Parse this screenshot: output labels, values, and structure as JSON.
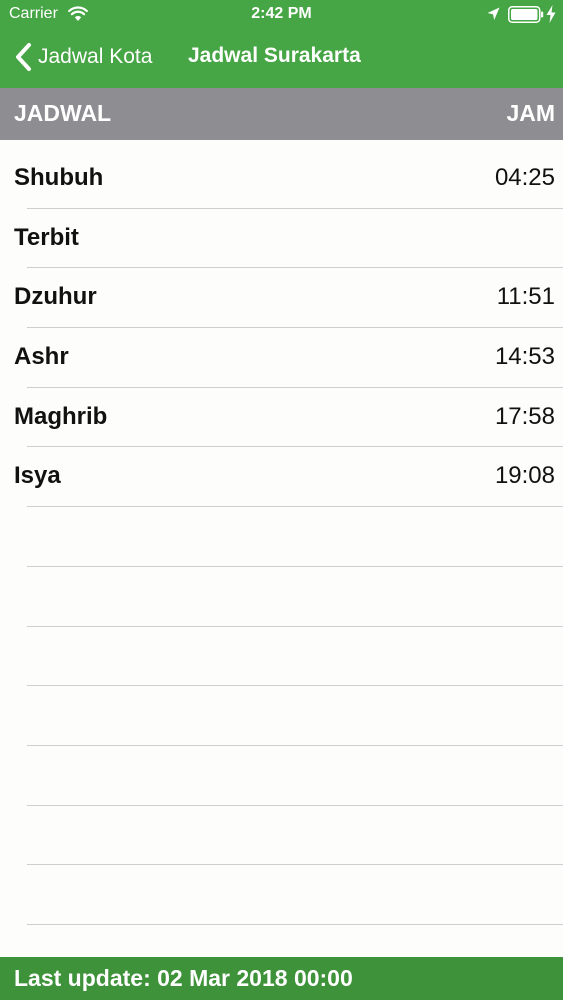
{
  "status_bar": {
    "carrier": "Carrier",
    "time": "2:42 PM",
    "icons": [
      "wifi-icon",
      "location-arrow-icon",
      "battery-icon",
      "charging-bolt-icon"
    ]
  },
  "nav": {
    "back_label": "Jadwal Kota",
    "title": "Jadwal Surakarta"
  },
  "table": {
    "headers": {
      "name": "JADWAL",
      "time": "JAM"
    },
    "rows": [
      {
        "name": "Shubuh",
        "time": "04:25"
      },
      {
        "name": "Terbit",
        "time": ""
      },
      {
        "name": "Dzuhur",
        "time": "11:51"
      },
      {
        "name": "Ashr",
        "time": "14:53"
      },
      {
        "name": "Maghrib",
        "time": "17:58"
      },
      {
        "name": "Isya",
        "time": "19:08"
      },
      {
        "name": "",
        "time": ""
      },
      {
        "name": "",
        "time": ""
      },
      {
        "name": "",
        "time": ""
      },
      {
        "name": "",
        "time": ""
      },
      {
        "name": "",
        "time": ""
      },
      {
        "name": "",
        "time": ""
      },
      {
        "name": "",
        "time": ""
      }
    ]
  },
  "footer": {
    "last_update": "Last update: 02 Mar 2018 00:00"
  },
  "colors": {
    "nav_green": "#46a544",
    "footer_green": "#3e9239",
    "header_gray": "#8e8e92",
    "background": "#fdfdfb",
    "separator": "#cfcfd2"
  }
}
